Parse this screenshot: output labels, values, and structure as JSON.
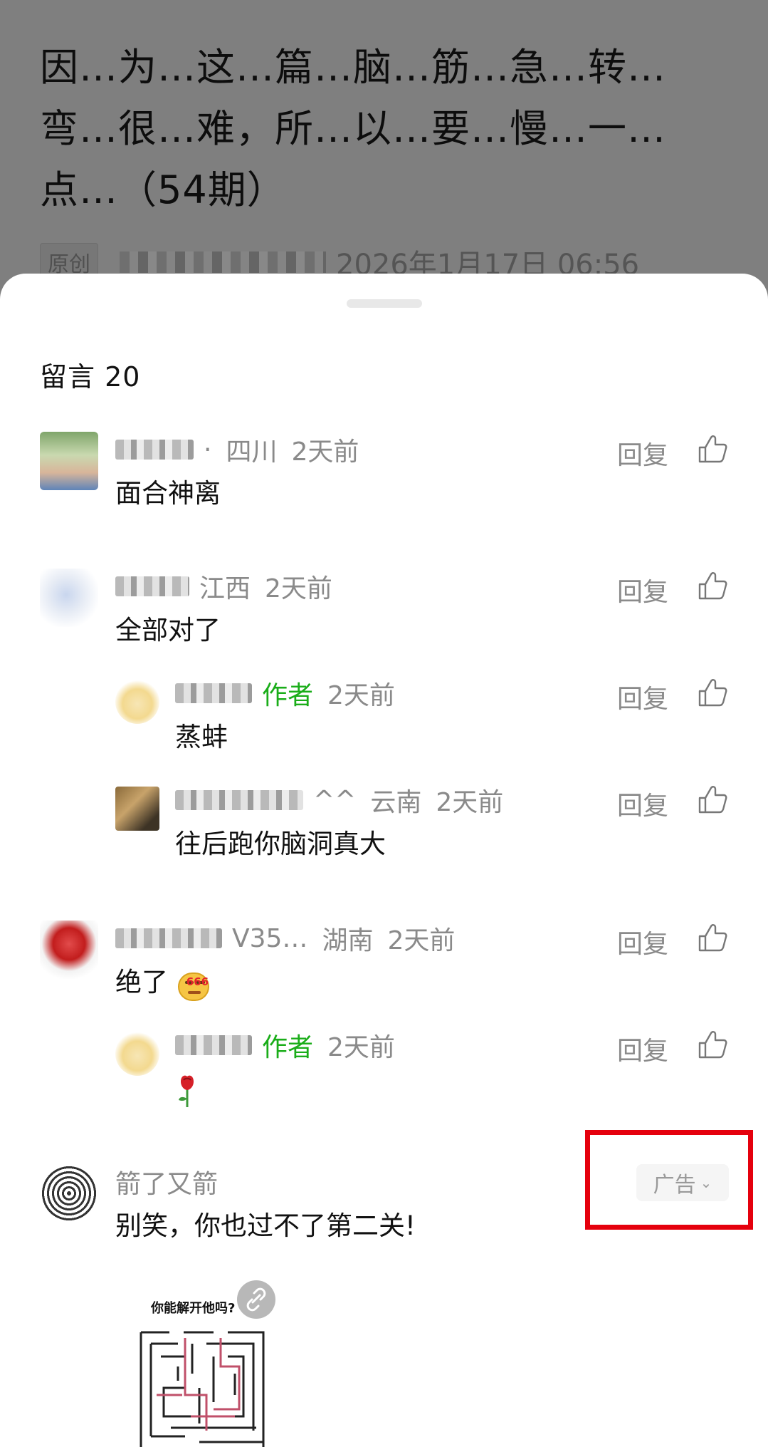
{
  "article": {
    "title": "因…为…这…篇…脑…筋…急…转…弯…很…难，所…以…要…慢…一…点…（54期）",
    "original_tag": "原创",
    "date": "2026年1月17日 06:56"
  },
  "comments_panel": {
    "title": "留言 20"
  },
  "comments": [
    {
      "name_suffix": "·",
      "location": "四川",
      "time": "2天前",
      "text": "面合神离",
      "reply_label": "回复"
    },
    {
      "name_suffix": "",
      "location": "江西",
      "time": "2天前",
      "text": "全部对了",
      "reply_label": "回复"
    },
    {
      "author_tag": "作者",
      "time": "2天前",
      "text": "蒸蚌",
      "reply_label": "回复"
    },
    {
      "name_suffix": "^^",
      "location": "云南",
      "time": "2天前",
      "text": "往后跑你脑洞真大",
      "reply_label": "回复"
    },
    {
      "name_suffix": "V35…",
      "location": "湖南",
      "time": "2天前",
      "text": "绝了",
      "emoji_badge": "666",
      "reply_label": "回复"
    },
    {
      "author_tag": "作者",
      "time": "2天前",
      "text": "🌹",
      "reply_label": "回复"
    }
  ],
  "ad": {
    "name": "箭了又箭",
    "badge": "广告",
    "text": "别笑，你也过不了第二关!",
    "image_caption": "你能解开他吗?"
  },
  "colors": {
    "author_green": "#1aad19",
    "highlight_red": "#e5000d",
    "overlay_gray": "#7f7f7f"
  }
}
